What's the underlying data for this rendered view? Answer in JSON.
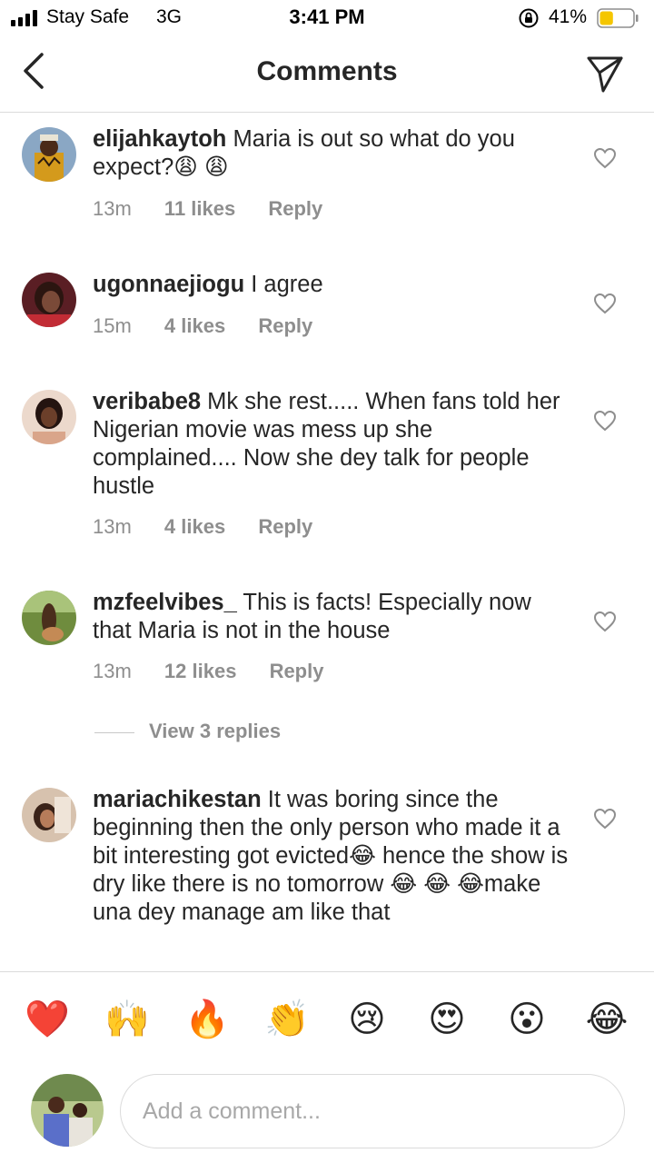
{
  "status_bar": {
    "carrier": "Stay Safe",
    "network": "3G",
    "time": "3:41 PM",
    "battery": "41%",
    "battery_level": 0.41
  },
  "header": {
    "title": "Comments",
    "back_icon": "chevron-left-icon",
    "share_icon": "paper-plane-icon"
  },
  "comments": [
    {
      "username": "elijahkaytoh",
      "text": "Maria is out so what do you expect?😩 😩",
      "time": "13m",
      "likes": "11 likes",
      "reply": "Reply"
    },
    {
      "username": "ugonnaejiogu",
      "text": "I agree",
      "time": "15m",
      "likes": "4 likes",
      "reply": "Reply"
    },
    {
      "username": "veribabe8",
      "text": "Mk she rest..... When fans told her Nigerian movie was mess up she complained.... Now she dey talk for people hustle",
      "time": "13m",
      "likes": "4 likes",
      "reply": "Reply"
    },
    {
      "username": "mzfeelvibes_",
      "text": "This is facts! Especially now that Maria is not in the house",
      "time": "13m",
      "likes": "12 likes",
      "reply": "Reply"
    },
    {
      "username": "mariachikestan",
      "text": "It was boring since the beginning then the only person who made it a bit interesting got evicted😂 hence the show is dry like there is no tomorrow 😂 😂 😂make una dey manage am like that"
    }
  ],
  "view_replies": "View 3 replies",
  "emoji_bar": [
    "❤️",
    "🙌",
    "🔥",
    "👏",
    "😢",
    "😍",
    "😮",
    "😂"
  ],
  "composer": {
    "placeholder": "Add a comment..."
  }
}
